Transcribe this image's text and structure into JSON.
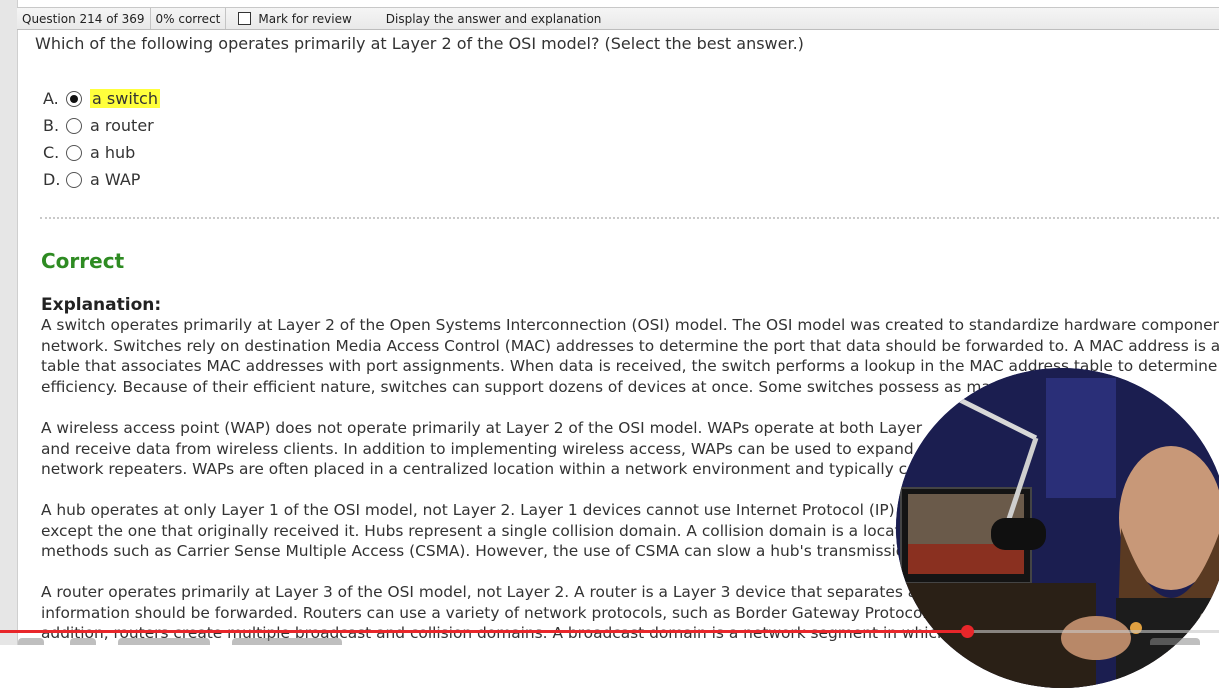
{
  "topbar": {
    "question_counter": "Question 214 of 369",
    "score": "0% correct",
    "mark_for_review": "Mark for review",
    "display_answer": "Display the answer and explanation"
  },
  "question": {
    "text": "Which of the following operates primarily at Layer 2 of the OSI model?  (Select the best answer.)"
  },
  "options": [
    {
      "letter": "A.",
      "label": "a switch",
      "selected": true
    },
    {
      "letter": "B.",
      "label": "a router",
      "selected": false
    },
    {
      "letter": "C.",
      "label": "a hub",
      "selected": false
    },
    {
      "letter": "D.",
      "label": "a WAP",
      "selected": false
    }
  ],
  "result": {
    "label": "Correct",
    "color": "#2e8b22"
  },
  "explanation": {
    "heading": "Explanation:",
    "paragraphs": [
      [
        "A switch operates primarily at Layer 2 of the Open Systems Interconnection (OSI) model. The OSI model was created to standardize hardware component",
        "network. Switches rely on destination Media Access Control (MAC) addresses to determine the port that data should be forwarded to. A MAC address is a u",
        "table that associates MAC addresses with port assignments. When data is received, the switch performs a lookup in the MAC address table to determine wh",
        "efficiency. Because of their efficient nature, switches can support dozens of devices at once. Some switches possess as many"
      ],
      [
        "A wireless access point (WAP) does not operate primarily at Layer 2 of the OSI model. WAPs operate at both Layer",
        "and receive data from wireless clients. In addition to implementing wireless access, WAPs can be used to expand e",
        "network repeaters. WAPs are often placed in a centralized location within a network environment and typically co"
      ],
      [
        "A hub operates at only Layer 1 of the OSI model, not Layer 2. Layer 1 devices cannot use Internet Protocol (IP)",
        "except the one that originally received it. Hubs represent a single collision domain. A collision domain is a locati",
        "methods such as Carrier Sense Multiple Access (CSMA). However, the use of CSMA can slow a hub's transmissio"
      ],
      [
        "A router operates primarily at Layer 3 of the OSI model, not Layer 2. A router is a Layer 3 device that separates a",
        "information should be forwarded. Routers can use a variety of network protocols, such as Border Gateway Protocol",
        "addition, routers create multiple broadcast and collision domains. A broadcast domain is a network segment in which"
      ]
    ]
  },
  "video": {
    "progress_fraction": 0.793,
    "accent_color": "#e8262a"
  }
}
